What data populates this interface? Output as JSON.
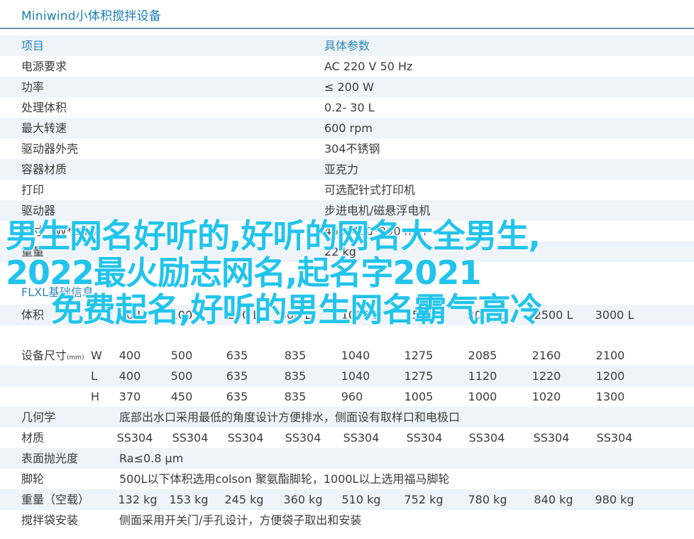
{
  "title": "Miniwind小体积搅拌设备",
  "spec_table": {
    "header": [
      "项目",
      "具体参数"
    ],
    "rows": [
      [
        "电源要求",
        "AC 220  V 50 Hz"
      ],
      [
        "功率",
        "≤ 200 W"
      ],
      [
        "处理体积",
        "0.2- 30 L"
      ],
      [
        "最大转速",
        "600  rpm"
      ],
      [
        "驱动器外壳",
        "304不锈钢"
      ],
      [
        "容器材质",
        "亚克力"
      ],
      [
        "打印",
        "可选配针式打印机"
      ],
      [
        "驱动器",
        "步进电机/磁悬浮电机"
      ],
      [
        "尺寸（W*L*H）",
        "450*450*290 mm"
      ],
      [
        "重量",
        "22 kg"
      ]
    ]
  },
  "section2_title": "FLXL基础信息",
  "model_table": {
    "volume_label": "体积",
    "volumes": [
      "50 L",
      "100 L",
      "200 L",
      "300 L",
      "1000 L",
      "1500 L",
      "2000 L",
      "2500 L",
      "3000 L"
    ],
    "size_label": "设备尺寸",
    "size_unit": "(mm)",
    "dims": [
      {
        "axis": "W",
        "values": [
          "400",
          "500",
          "635",
          "835",
          "1040",
          "1275",
          "2085",
          "2160",
          "2100"
        ]
      },
      {
        "axis": "L",
        "values": [
          "400",
          "500",
          "635",
          "835",
          "1040",
          "1275",
          "1120",
          "1220",
          "1200"
        ]
      },
      {
        "axis": "H",
        "values": [
          "370",
          "450",
          "635",
          "835",
          "960",
          "1005",
          "1000",
          "1020",
          "1300"
        ]
      }
    ],
    "geometry_label": "几何学",
    "geometry_text": "底部出水口采用最低的角度设计方便排水，侧面设有取样口和电极口",
    "material_label": "材质",
    "materials": [
      "SS304",
      "SS304",
      "SS304",
      "SS304",
      "SS304",
      "SS304",
      "SS304",
      "SS304",
      "SS304"
    ],
    "polish_label": "表面抛光度",
    "polish_text": "Ra≤0.8 μm",
    "casters_label": "脚轮",
    "casters_text": "500L以下体积选用colson 聚氨酯脚轮，1000L以上选用福马脚轮",
    "weight_label": "重量（空载）",
    "weights": [
      "132 kg",
      "153 kg",
      "245 kg",
      "360 kg",
      "510 kg",
      "752 kg",
      "780 kg",
      "840 kg",
      "980 kg"
    ],
    "bag_label": "搅拌袋安装",
    "bag_text": "侧面采用开关门/手孔设计，方便袋子取出和安装"
  },
  "overlay": {
    "line1": "男生网名好听的,好听的网名大全男生,",
    "line2": "2022最火励志网名,起名字2021",
    "line3": "免费起名,好听的男生网名霸气高冷",
    "color": "#22c4ec"
  }
}
